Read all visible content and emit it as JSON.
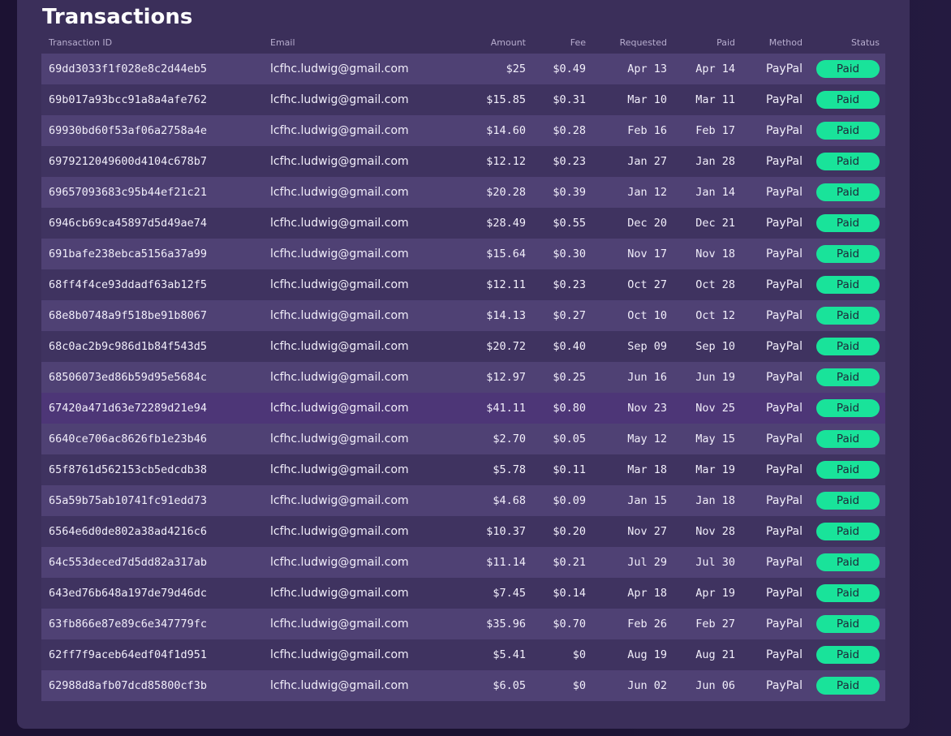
{
  "title": "Transactions",
  "columns": {
    "id": "Transaction ID",
    "email": "Email",
    "amount": "Amount",
    "fee": "Fee",
    "requested": "Requested",
    "paid": "Paid",
    "method": "Method",
    "status": "Status"
  },
  "colors": {
    "status_paid": "#19e39a",
    "panel": "#3b2f5a",
    "row_odd": "#4f4174",
    "row_even": "#3f3360"
  },
  "rows": [
    {
      "id": "69dd3033f1f028e8c2d44eb5",
      "email": "lcfhc.ludwig@gmail.com",
      "amount": "$25",
      "fee": "$0.49",
      "requested": "Apr 13",
      "paid": "Apr 14",
      "method": "PayPal",
      "status": "Paid"
    },
    {
      "id": "69b017a93bcc91a8a4afe762",
      "email": "lcfhc.ludwig@gmail.com",
      "amount": "$15.85",
      "fee": "$0.31",
      "requested": "Mar 10",
      "paid": "Mar 11",
      "method": "PayPal",
      "status": "Paid"
    },
    {
      "id": "69930bd60f53af06a2758a4e",
      "email": "lcfhc.ludwig@gmail.com",
      "amount": "$14.60",
      "fee": "$0.28",
      "requested": "Feb 16",
      "paid": "Feb 17",
      "method": "PayPal",
      "status": "Paid"
    },
    {
      "id": "6979212049600d4104c678b7",
      "email": "lcfhc.ludwig@gmail.com",
      "amount": "$12.12",
      "fee": "$0.23",
      "requested": "Jan 27",
      "paid": "Jan 28",
      "method": "PayPal",
      "status": "Paid"
    },
    {
      "id": "69657093683c95b44ef21c21",
      "email": "lcfhc.ludwig@gmail.com",
      "amount": "$20.28",
      "fee": "$0.39",
      "requested": "Jan 12",
      "paid": "Jan 14",
      "method": "PayPal",
      "status": "Paid"
    },
    {
      "id": "6946cb69ca45897d5d49ae74",
      "email": "lcfhc.ludwig@gmail.com",
      "amount": "$28.49",
      "fee": "$0.55",
      "requested": "Dec 20",
      "paid": "Dec 21",
      "method": "PayPal",
      "status": "Paid"
    },
    {
      "id": "691bafe238ebca5156a37a99",
      "email": "lcfhc.ludwig@gmail.com",
      "amount": "$15.64",
      "fee": "$0.30",
      "requested": "Nov 17",
      "paid": "Nov 18",
      "method": "PayPal",
      "status": "Paid"
    },
    {
      "id": "68ff4f4ce93ddadf63ab12f5",
      "email": "lcfhc.ludwig@gmail.com",
      "amount": "$12.11",
      "fee": "$0.23",
      "requested": "Oct 27",
      "paid": "Oct 28",
      "method": "PayPal",
      "status": "Paid"
    },
    {
      "id": "68e8b0748a9f518be91b8067",
      "email": "lcfhc.ludwig@gmail.com",
      "amount": "$14.13",
      "fee": "$0.27",
      "requested": "Oct 10",
      "paid": "Oct 12",
      "method": "PayPal",
      "status": "Paid"
    },
    {
      "id": "68c0ac2b9c986d1b84f543d5",
      "email": "lcfhc.ludwig@gmail.com",
      "amount": "$20.72",
      "fee": "$0.40",
      "requested": "Sep 09",
      "paid": "Sep 10",
      "method": "PayPal",
      "status": "Paid"
    },
    {
      "id": "68506073ed86b59d95e5684c",
      "email": "lcfhc.ludwig@gmail.com",
      "amount": "$12.97",
      "fee": "$0.25",
      "requested": "Jun 16",
      "paid": "Jun 19",
      "method": "PayPal",
      "status": "Paid"
    },
    {
      "id": "67420a471d63e72289d21e94",
      "email": "lcfhc.ludwig@gmail.com",
      "amount": "$41.11",
      "fee": "$0.80",
      "requested": "Nov 23",
      "paid": "Nov 25",
      "method": "PayPal",
      "status": "Paid"
    },
    {
      "id": "6640ce706ac8626fb1e23b46",
      "email": "lcfhc.ludwig@gmail.com",
      "amount": "$2.70",
      "fee": "$0.05",
      "requested": "May 12",
      "paid": "May 15",
      "method": "PayPal",
      "status": "Paid"
    },
    {
      "id": "65f8761d562153cb5edcdb38",
      "email": "lcfhc.ludwig@gmail.com",
      "amount": "$5.78",
      "fee": "$0.11",
      "requested": "Mar 18",
      "paid": "Mar 19",
      "method": "PayPal",
      "status": "Paid"
    },
    {
      "id": "65a59b75ab10741fc91edd73",
      "email": "lcfhc.ludwig@gmail.com",
      "amount": "$4.68",
      "fee": "$0.09",
      "requested": "Jan 15",
      "paid": "Jan 18",
      "method": "PayPal",
      "status": "Paid"
    },
    {
      "id": "6564e6d0de802a38ad4216c6",
      "email": "lcfhc.ludwig@gmail.com",
      "amount": "$10.37",
      "fee": "$0.20",
      "requested": "Nov 27",
      "paid": "Nov 28",
      "method": "PayPal",
      "status": "Paid"
    },
    {
      "id": "64c553deced7d5dd82a317ab",
      "email": "lcfhc.ludwig@gmail.com",
      "amount": "$11.14",
      "fee": "$0.21",
      "requested": "Jul 29",
      "paid": "Jul 30",
      "method": "PayPal",
      "status": "Paid"
    },
    {
      "id": "643ed76b648a197de79d46dc",
      "email": "lcfhc.ludwig@gmail.com",
      "amount": "$7.45",
      "fee": "$0.14",
      "requested": "Apr 18",
      "paid": "Apr 19",
      "method": "PayPal",
      "status": "Paid"
    },
    {
      "id": "63fb866e87e89c6e347779fc",
      "email": "lcfhc.ludwig@gmail.com",
      "amount": "$35.96",
      "fee": "$0.70",
      "requested": "Feb 26",
      "paid": "Feb 27",
      "method": "PayPal",
      "status": "Paid"
    },
    {
      "id": "62ff7f9aceb64edf04f1d951",
      "email": "lcfhc.ludwig@gmail.com",
      "amount": "$5.41",
      "fee": "$0",
      "requested": "Aug 19",
      "paid": "Aug 21",
      "method": "PayPal",
      "status": "Paid"
    },
    {
      "id": "62988d8afb07dcd85800cf3b",
      "email": "lcfhc.ludwig@gmail.com",
      "amount": "$6.05",
      "fee": "$0",
      "requested": "Jun 02",
      "paid": "Jun 06",
      "method": "PayPal",
      "status": "Paid"
    }
  ]
}
